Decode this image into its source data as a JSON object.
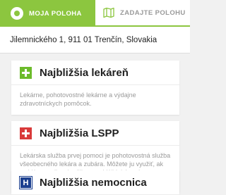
{
  "tabs": {
    "my_location": "MOJA POLOHA",
    "enter_location": "ZADAJTE POLOHU"
  },
  "address": "Jilemnického 1, 911 01 Trenčín, Slovakia",
  "cards": [
    {
      "title": "Najbližšia lekáreň",
      "description": "Lekárne, pohotovostné lekárne a výdajne zdravotníckych pomôcok.",
      "icon": "green-cross-icon"
    },
    {
      "title": "Najbližšia LSPP",
      "description": "Lekárska služba prvej pomoci je pohotovostná služba všeobecného lekára a zubára. Môžete ju využiť, ak sa Vám prudko zhoršil stav a Váš lekár práve neordinuje.",
      "icon": "red-cross-icon"
    },
    {
      "title": "Najbližšia nemocnica",
      "icon_letter": "H",
      "icon": "hospital-icon"
    }
  ],
  "colors": {
    "accent": "#8cc63f",
    "pharmacy": "#6cbb2b",
    "emergency": "#d93a3a",
    "hospital": "#1b3f8f"
  }
}
